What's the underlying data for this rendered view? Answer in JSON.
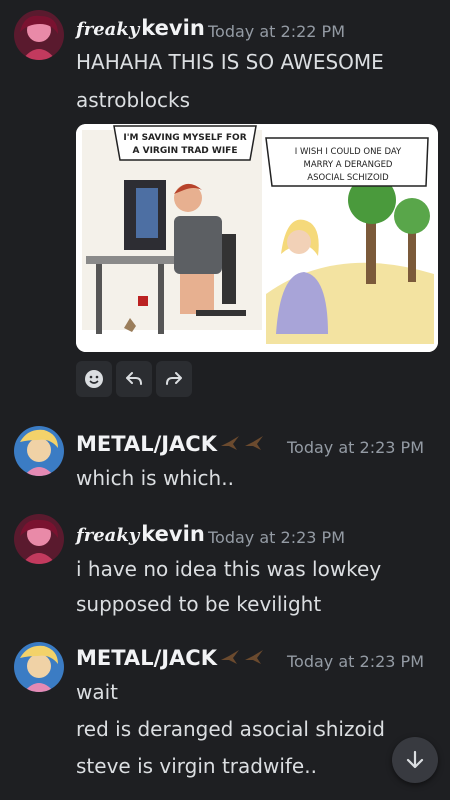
{
  "messages": [
    {
      "username_prefix": "freaky",
      "username": "kevin",
      "timestamp": "Today at 2:22 PM",
      "lines": [
        "HAHAHA THIS IS SO AWESOME",
        "astroblocks"
      ],
      "image": {
        "caption_left": "I'M SAVING MYSELF FOR A VIRGIN TRAD WIFE",
        "caption_right": "I WISH I COULD ONE DAY MARRY A DERANGED ASOCIAL SCHIZOID"
      },
      "actions": [
        "smile-add-reaction",
        "reply",
        "forward"
      ]
    },
    {
      "username": "METAL/JACK",
      "timestamp": "Today at 2:23 PM",
      "lines": [
        "which is which.."
      ]
    },
    {
      "username_prefix": "freaky",
      "username": "kevin",
      "timestamp": "Today at 2:23 PM",
      "lines": [
        "i have no idea this was lowkey",
        "supposed to be kevilight"
      ]
    },
    {
      "username": "METAL/JACK",
      "timestamp": "Today at 2:23 PM",
      "lines": [
        "wait",
        "red is deranged asocial shizoid",
        "steve is virgin tradwife.."
      ]
    }
  ],
  "colors": {
    "background": "#1e1f22",
    "text": "#dbdee1",
    "timestamp": "#949ba4"
  },
  "icons": [
    "avatar-pink",
    "avatar-blue",
    "bird-emoji",
    "arrow-down-icon"
  ]
}
